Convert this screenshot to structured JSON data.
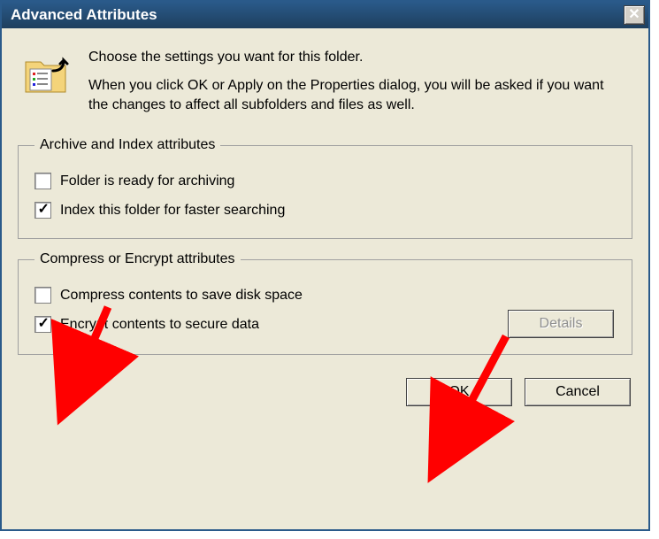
{
  "window": {
    "title": "Advanced Attributes"
  },
  "intro": {
    "line1": "Choose the settings you want for this folder.",
    "line2": "When you click OK or Apply on the Properties dialog, you will be asked if you want the changes to affect all subfolders and files as well."
  },
  "group1": {
    "legend": "Archive and Index attributes",
    "opt1": {
      "label": "Folder is ready for archiving",
      "checked": false
    },
    "opt2": {
      "label": "Index this folder for faster searching",
      "checked": true
    }
  },
  "group2": {
    "legend": "Compress or Encrypt attributes",
    "opt1": {
      "label": "Compress contents to save disk space",
      "checked": false
    },
    "opt2": {
      "label": "Encrypt contents to secure data",
      "checked": true
    },
    "details": {
      "label": "Details",
      "enabled": false
    }
  },
  "buttons": {
    "ok": "OK",
    "cancel": "Cancel"
  },
  "icons": {
    "close": "✕"
  }
}
